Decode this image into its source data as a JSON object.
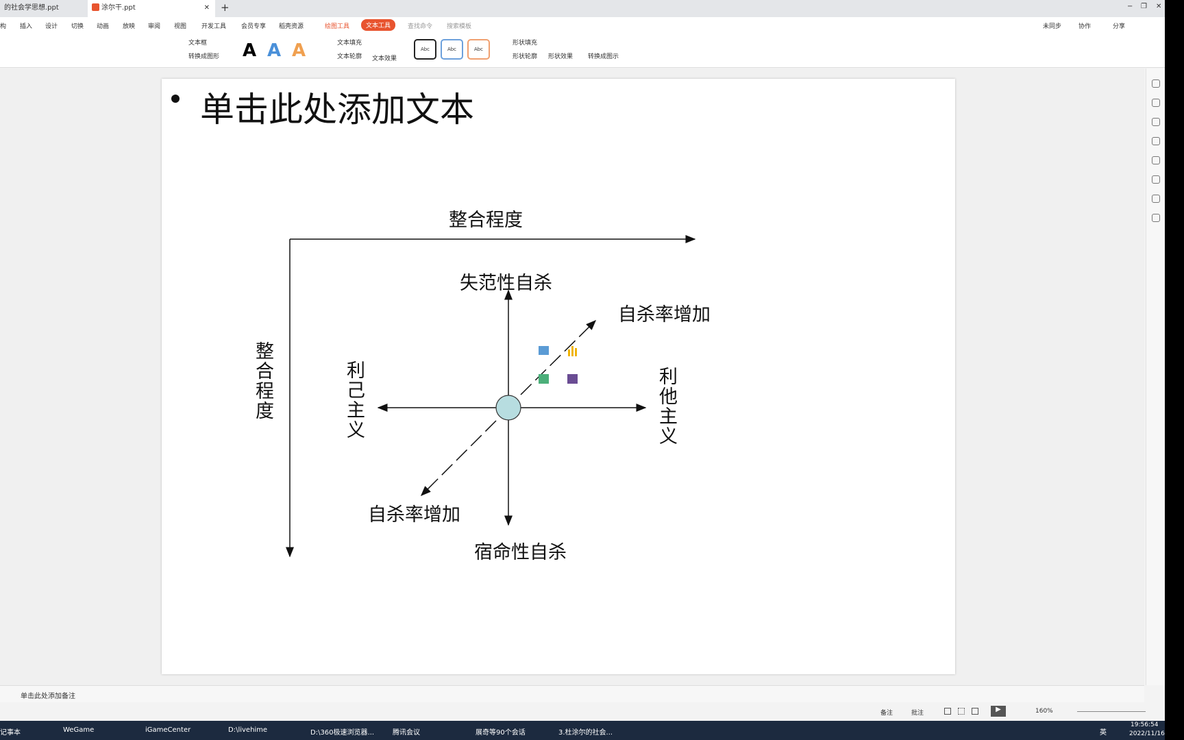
{
  "tabs": [
    {
      "label": "的社会学思想.ppt"
    },
    {
      "label": "涂尔干.ppt"
    }
  ],
  "window_controls": {
    "minimize": "−",
    "restore": "❐",
    "close": "✕",
    "new_tab": "+"
  },
  "menu": [
    "构",
    "插入",
    "设计",
    "切换",
    "动画",
    "放映",
    "审阅",
    "视图",
    "开发工具",
    "会员专享",
    "稻壳资源",
    "绘图工具",
    "文本工具",
    "查找命令",
    "搜索模板"
  ],
  "menu_right": [
    "未同步",
    "协作",
    "分享"
  ],
  "toolbar": {
    "text_box": "文本框",
    "smart_shape": "转换成图形",
    "text_fill": "文本填充",
    "text_outline": "文本轮廓",
    "text_effect": "文本效果",
    "shape_fill": "形状填充",
    "shape_outline": "形状轮廓",
    "shape_effect": "形状效果",
    "convert_smartart": "转换成图示",
    "style_sample": "Abc"
  },
  "accent": "#e8542f",
  "slide": {
    "title": "单击此处添加文本",
    "top_label": "整合程度",
    "left_label": "整合程度",
    "up_label": "失范性自杀",
    "down_label": "宿命性自杀",
    "left_arrow_label": "利己主义",
    "right_arrow_label": "利他主义",
    "diag_up_label": "自杀率增加",
    "diag_down_label": "自杀率增加",
    "circle_color": "#b7dde0"
  },
  "notes": "单击此处添加备注",
  "status": {
    "notes_btn": "备注",
    "comment_btn": "批注",
    "zoom": "160%"
  },
  "taskbar": [
    "记事本",
    "WeGame",
    "iGameCenter",
    "D:\\livehime",
    "D:\\360极速浏览器...",
    "腾讯会议",
    "展奇等90个会话",
    "3.杜涂尔的社会..."
  ],
  "tray": {
    "lang": "英",
    "time": "19:56:54",
    "date": "2022/11/16"
  }
}
